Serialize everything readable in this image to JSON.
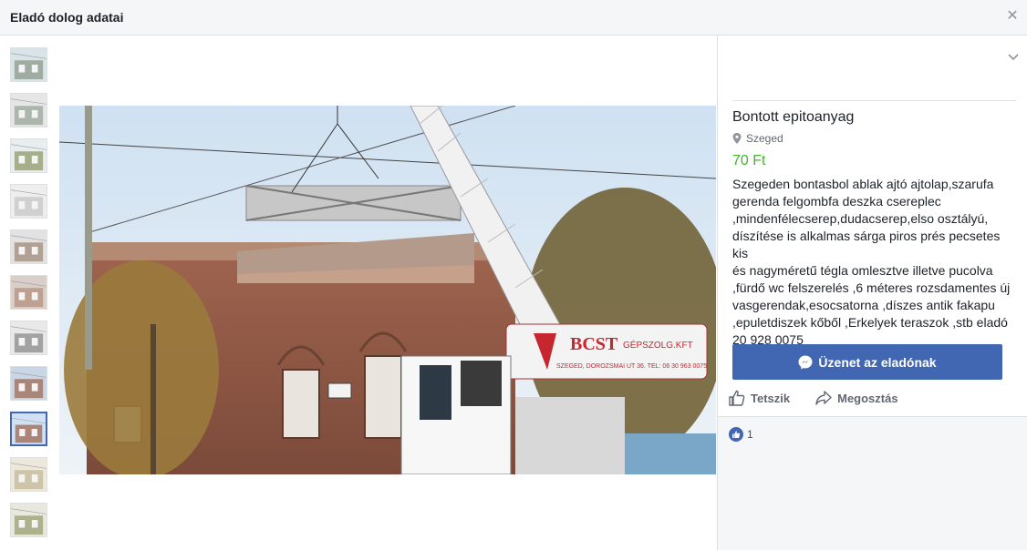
{
  "dialog": {
    "title": "Eladó dolog adatai",
    "close_icon": "close-icon"
  },
  "gallery": {
    "thumbnail_count": 11,
    "active_index": 8
  },
  "listing": {
    "title": "Bontott epitoanyag",
    "location": "Szeged",
    "price": "70 Ft",
    "description": "Szegeden bontasbol ablak ajtó ajtolap,szarufa\ngerenda felgombfa deszka csereplec\n,mindenfélecserep,dudacserep,elso osztályú,\ndíszítése is alkalmas sárga piros prés pecsetes kis\nés nagyméretű tégla omlesztve illetve pucolva\n,fürdő wc felszerelés ,6 méteres rozsdamentes új\nvasgerendak,esocsatorna ,díszes antik fakapu\n,epuletdiszek kőből ,Erkelyek teraszok ,stb eladó\n20 928 0075"
  },
  "photo_sign": {
    "brand": "BCST",
    "brand_suffix": "GÉPSZOLG.KFT",
    "address": "SZEGED, DOROZSMAI UT 36. TEL: 06 30 963 0075"
  },
  "actions": {
    "message_button": "Üzenet az eladónak",
    "like": "Tetszik",
    "share": "Megosztás"
  },
  "reactions": {
    "count": "1"
  },
  "colors": {
    "accent": "#4267b2",
    "price": "#42b72a",
    "header_bg": "#f5f6f7"
  }
}
